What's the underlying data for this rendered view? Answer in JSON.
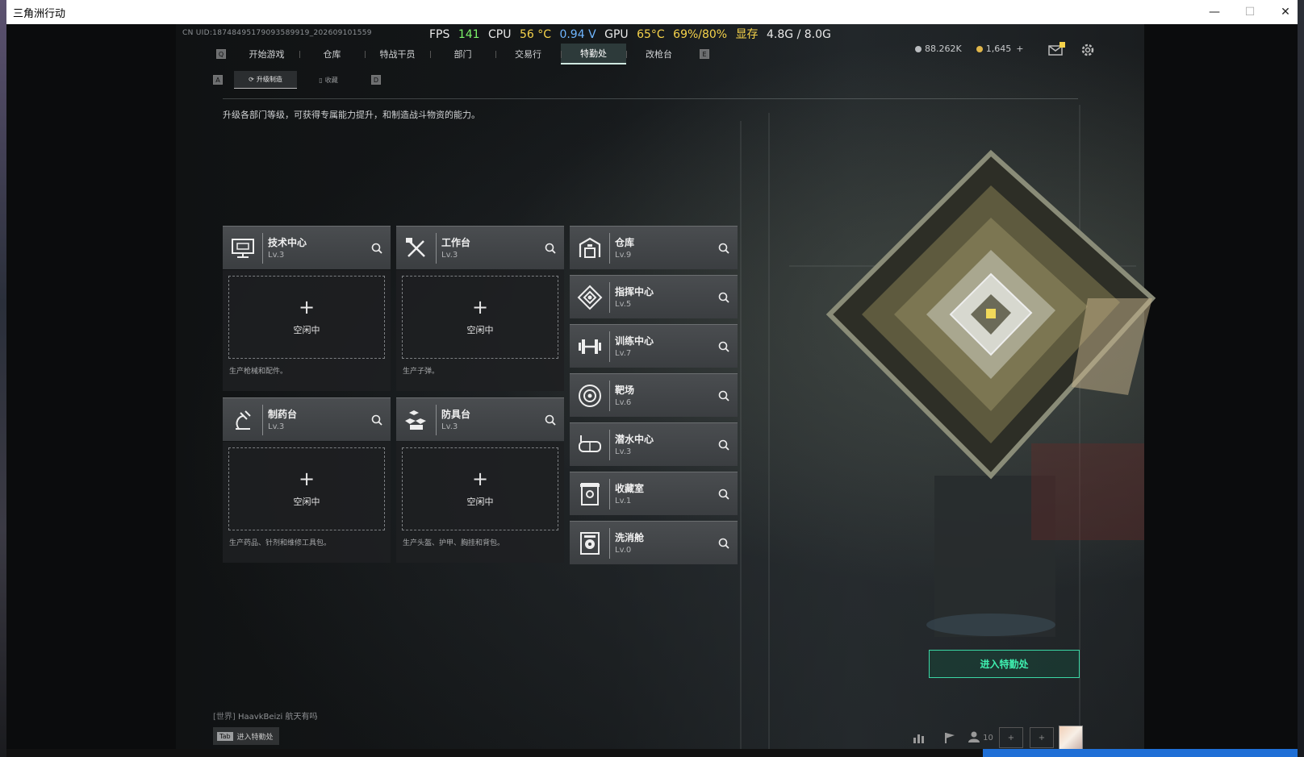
{
  "window": {
    "title": "三角洲行动",
    "minimize": "—",
    "maximize": "☐",
    "close": "✕"
  },
  "perf": {
    "fps_label": "FPS",
    "fps": "141",
    "cpu_label": "CPU",
    "cpu_temp": "56 °C",
    "cpu_volt": "0.94 V",
    "gpu_label": "GPU",
    "gpu_temp": "65°C",
    "gpu_load": "69%/80%",
    "vram_label": "显存",
    "vram": "4.8G / 8.0G"
  },
  "uid": "CN UID:18748495179093589919_202609101559",
  "nav": {
    "left_key": "Q",
    "right_key": "E",
    "tabs": [
      "开始游戏",
      "仓库",
      "特战干员",
      "部门",
      "交易行",
      "特勤处",
      "改枪台"
    ],
    "active": "特勤处"
  },
  "subnav": {
    "left_key": "A",
    "right_key": "D",
    "tabs": [
      "升级制造",
      "收藏"
    ],
    "active": "升级制造"
  },
  "currency": {
    "a": "88.262K",
    "b": "1,645",
    "add": "+"
  },
  "colors": {
    "accent": "#3ff0b0",
    "fps": "#7cf36a",
    "temp": "#f5d24a",
    "volt": "#6fb6ff"
  },
  "description": "升级各部门等级，可获得专属能力提升，和制造战斗物资的能力。",
  "idle_label": "空闲中",
  "production": [
    {
      "name": "技术中心",
      "level": "Lv.3",
      "icon": "monitor-icon",
      "desc": "生产枪械和配件。"
    },
    {
      "name": "工作台",
      "level": "Lv.3",
      "icon": "tools-icon",
      "desc": "生产子弹。"
    },
    {
      "name": "制药台",
      "level": "Lv.3",
      "icon": "pharmacy-icon",
      "desc": "生产药品、针剂和维修工具包。"
    },
    {
      "name": "防具台",
      "level": "Lv.3",
      "icon": "armor-icon",
      "desc": "生产头盔、护甲、胸挂和背包。"
    }
  ],
  "departments": [
    {
      "name": "仓库",
      "level": "Lv.9",
      "icon": "warehouse-icon"
    },
    {
      "name": "指挥中心",
      "level": "Lv.5",
      "icon": "command-icon"
    },
    {
      "name": "训练中心",
      "level": "Lv.7",
      "icon": "dumbbell-icon"
    },
    {
      "name": "靶场",
      "level": "Lv.6",
      "icon": "target-icon"
    },
    {
      "name": "潜水中心",
      "level": "Lv.3",
      "icon": "diving-mask-icon"
    },
    {
      "name": "收藏室",
      "level": "Lv.1",
      "icon": "collection-icon"
    },
    {
      "name": "洗消舱",
      "level": "Lv.0",
      "icon": "radiation-icon"
    }
  ],
  "enter_button": "进入特勤处",
  "chat": {
    "channel": "[世界]",
    "user": "HaavkBeizi",
    "message": "航天有吗"
  },
  "tab_hint": {
    "key": "Tab",
    "label": "进入特勤处"
  },
  "friends_count": "10"
}
